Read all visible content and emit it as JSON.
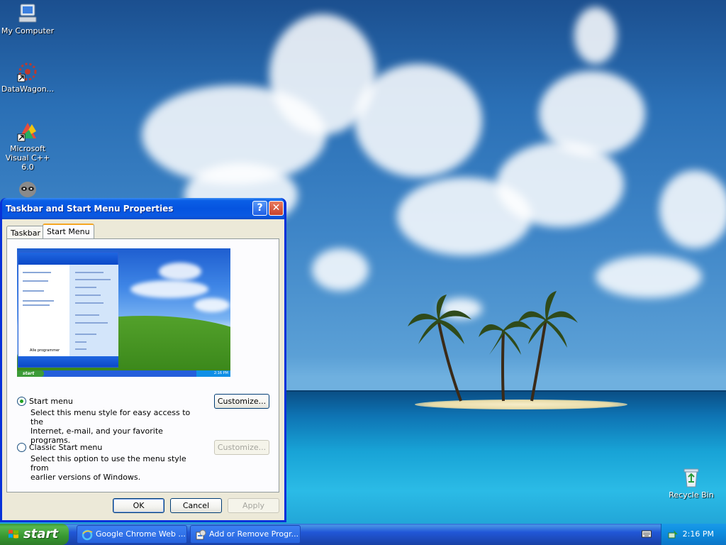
{
  "desktop": {
    "icons": [
      {
        "label": "My Computer",
        "icon": "my-computer-icon"
      },
      {
        "label": "DataWagon...",
        "icon": "datawagon-icon"
      },
      {
        "label": "Microsoft Visual C++ 6.0",
        "icon": "visual-cpp-icon"
      },
      {
        "label": "",
        "icon": "raccoon-icon"
      },
      {
        "label": "Recycle Bin",
        "icon": "recycle-bin-icon"
      }
    ]
  },
  "window": {
    "title": "Taskbar and Start Menu Properties",
    "help_glyph": "?",
    "close_glyph": "✕",
    "tabs": [
      {
        "label": "Taskbar",
        "active": false
      },
      {
        "label": "Start Menu",
        "active": true
      }
    ],
    "preview": {
      "start_label": "start",
      "clock": "2:16 PM",
      "all_programs": "Alle programmer"
    },
    "options": [
      {
        "label": "Start menu",
        "selected": true,
        "description_line1": "Select this menu style for easy access to the",
        "description_line2": "Internet, e-mail, and your favorite programs.",
        "customize_label": "Customize...",
        "customize_enabled": true
      },
      {
        "label": "Classic Start menu",
        "selected": false,
        "description_line1": "Select this option to use the menu style from",
        "description_line2": "earlier versions of Windows.",
        "customize_label": "Customize...",
        "customize_enabled": false
      }
    ],
    "buttons": {
      "ok": "OK",
      "cancel": "Cancel",
      "apply": "Apply"
    }
  },
  "taskbar": {
    "start_label": "start",
    "tasks": [
      {
        "label": "Google Chrome Web ...",
        "icon": "ie-icon"
      },
      {
        "label": "Add or Remove Progr...",
        "icon": "add-remove-programs-icon"
      }
    ],
    "clock": "2:16 PM"
  },
  "colors": {
    "xp_blue": "#0831d9",
    "start_green": "#3c9b38",
    "tray_blue": "#0e8ee0",
    "dialog_face": "#ece9d8"
  }
}
